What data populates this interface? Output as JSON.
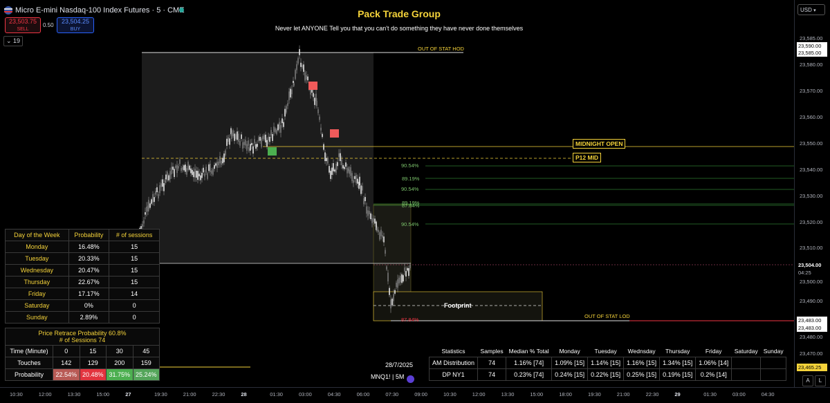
{
  "header": {
    "instrument": "Micro E-mini Nasdaq-100 Index Futures · 5 · CME",
    "sell_price": "23,503.75",
    "sell_label": "SELL",
    "spread": "0.50",
    "buy_price": "23,504.25",
    "buy_label": "BUY",
    "indicator_count": "19",
    "collapse_icon": "chevron-down-icon"
  },
  "overlay": {
    "title": "Pack Trade Group",
    "tagline": "Never let ANYONE Tell you that you can't do something they have never done themselves"
  },
  "levels": {
    "out_of_stat_hod": "OUT OF STAT HOD",
    "midnight_open": "MIDNIGHT OPEN",
    "p12_mid": "P12 MID",
    "out_of_stat_lod": "OUT OF STAT LOD",
    "footprint": "Footprint",
    "pct_labels": [
      "90.54%",
      "89.19%",
      "90.54%",
      "89.19%",
      "87.84%",
      "90.54%"
    ],
    "pct_red": "87.84%"
  },
  "price_axis": {
    "currency": "USD",
    "ticks": [
      "23,585.00",
      "23,580.00",
      "23,570.00",
      "23,560.00",
      "23,550.00",
      "23,540.00",
      "23,530.00",
      "23,520.00",
      "23,510.00",
      "23,500.00",
      "23,490.00",
      "23,480.00",
      "23,470.00"
    ],
    "high_tag_1": "23,590.00",
    "high_tag_2": "23,585.00",
    "last_price": "23,504.00",
    "countdown": "04:25",
    "low_tag_1": "23,483.00",
    "low_tag_2": "23,483.00",
    "stat_tag": "23,465.25",
    "auto_label": "A",
    "log_label": "L"
  },
  "time_axis": [
    "10:30",
    "12:00",
    "13:30",
    "15:00",
    "27",
    "19:30",
    "21:00",
    "22:30",
    "28",
    "01:30",
    "03:00",
    "04:30",
    "06:00",
    "07:30",
    "09:00",
    "10:30",
    "12:00",
    "13:30",
    "15:00",
    "18:00",
    "19:30",
    "21:00",
    "22:30",
    "29",
    "01:30",
    "03:00",
    "04:30"
  ],
  "dow_table": {
    "headers": [
      "Day of the Week",
      "Probability",
      "# of sessions"
    ],
    "rows": [
      [
        "Monday",
        "16.48%",
        "15"
      ],
      [
        "Tuesday",
        "20.33%",
        "15"
      ],
      [
        "Wednesday",
        "20.47%",
        "15"
      ],
      [
        "Thursday",
        "22.67%",
        "15"
      ],
      [
        "Friday",
        "17.17%",
        "14"
      ],
      [
        "Saturday",
        "0%",
        "0"
      ],
      [
        "Sunday",
        "2.89%",
        "0"
      ]
    ],
    "retrace_line1": "Price Retrace Probability 60.8%",
    "retrace_line2": "# of Sessions 74",
    "time_row": [
      "Time (Minute)",
      "0",
      "15",
      "30",
      "45"
    ],
    "touches_row": [
      "Touches",
      "142",
      "129",
      "200",
      "159"
    ],
    "prob_row": [
      "Probability",
      "22.54%",
      "20.48%",
      "31.75%",
      "25.24%"
    ],
    "prob_colors": [
      "#b85a55",
      "#e2333e",
      "#4caf50",
      "#54a55a"
    ]
  },
  "stats_table": {
    "headers": [
      "Statistics",
      "Samples",
      "Median % Total",
      "Monday",
      "Tuesday",
      "Wednsday",
      "Thursday",
      "Friday",
      "Saturday",
      "Sunday"
    ],
    "rows": [
      [
        "AM Distribution",
        "74",
        "1.16% [74]",
        "1.09% [15]",
        "1.14% [15]",
        "1.16% [15]",
        "1.34% [15]",
        "1.06% [14]",
        "",
        ""
      ],
      [
        "DP NY1",
        "74",
        "0.23% [74]",
        "0.24% [15]",
        "0.22% [15]",
        "0.25% [15]",
        "0.19% [15]",
        "0.2% [14]",
        "",
        ""
      ]
    ]
  },
  "footer": {
    "date": "28/7/2025",
    "symbol": "MNQ1! | 5M"
  },
  "colors": {
    "up": "#c8c8c8",
    "accent_yellow": "#f5d33a",
    "green_level": "#2e7d32",
    "red": "#f23645"
  }
}
